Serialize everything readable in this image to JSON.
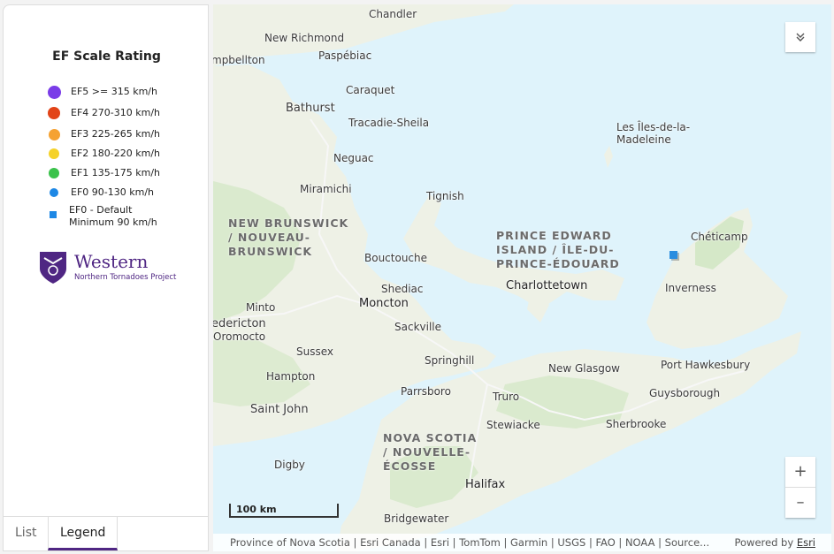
{
  "legend": {
    "title": "EF Scale Rating",
    "items": [
      {
        "code": "EF5",
        "range": ">= 315 km/h",
        "color": "#7a3ce8"
      },
      {
        "code": "EF4",
        "range": "270-310 km/h",
        "color": "#e24418"
      },
      {
        "code": "EF3",
        "range": "225-265 km/h",
        "color": "#f5a232"
      },
      {
        "code": "EF2",
        "range": "180-220 km/h",
        "color": "#f5d22a"
      },
      {
        "code": "EF1",
        "range": "135-175 km/h",
        "color": "#3ac24b"
      },
      {
        "code": "EF0",
        "range": "90-130 km/h",
        "color": "#1e88e5"
      }
    ],
    "default_line1": "EF0 - Default",
    "default_line2": "Minimum 90 km/h",
    "logo_word": "Western",
    "logo_sub": "Northern Tornadoes Project"
  },
  "tabs": {
    "list": "List",
    "legend": "Legend"
  },
  "map": {
    "places": [
      "Chandler",
      "New Richmond",
      "Paspébiac",
      "mpbellton",
      "Caraquet",
      "Bathurst",
      "Tracadie-Sheila",
      "Neguac",
      "Miramichi",
      "Tignish",
      "Bouctouche",
      "Shediac",
      "Minto",
      "edericton",
      "Oromocto",
      "Sussex",
      "Hampton",
      "Saint John",
      "Sackville",
      "Springhill",
      "Parrsboro",
      "Truro",
      "Stewiacke",
      "New Glasgow",
      "Port Hawkesbury",
      "Guysborough",
      "Sherbrooke",
      "Digby",
      "Bridgewater",
      "Inverness",
      "Chéticamp",
      "Les Îles-de-la-",
      "Madeleine"
    ],
    "provinces": {
      "nb": [
        "NEW BRUNSWICK",
        "/ NOUVEAU-",
        "BRUNSWICK"
      ],
      "pei": [
        "PRINCE EDWARD",
        "ISLAND / ÎLE-DU-",
        "PRINCE-ÉDOUARD"
      ],
      "ns": [
        "NOVA SCOTIA",
        "/ NOUVELLE-",
        "ÉCOSSE"
      ]
    },
    "cities": [
      "Charlottetown",
      "Moncton",
      "Halifax"
    ],
    "scale_label": "100 km",
    "attribution": "Province of Nova Scotia | Esri Canada | Esri | TomTom | Garmin | USGS | FAO | NOAA | Source...",
    "powered_by": "Powered by",
    "powered_link": "Esri",
    "zoom_in": "+",
    "zoom_out": "–"
  },
  "colors": {
    "water": "#dff3fb",
    "land": "#eef1e6",
    "green": "#d5e8c8",
    "brand": "#4f2683"
  }
}
